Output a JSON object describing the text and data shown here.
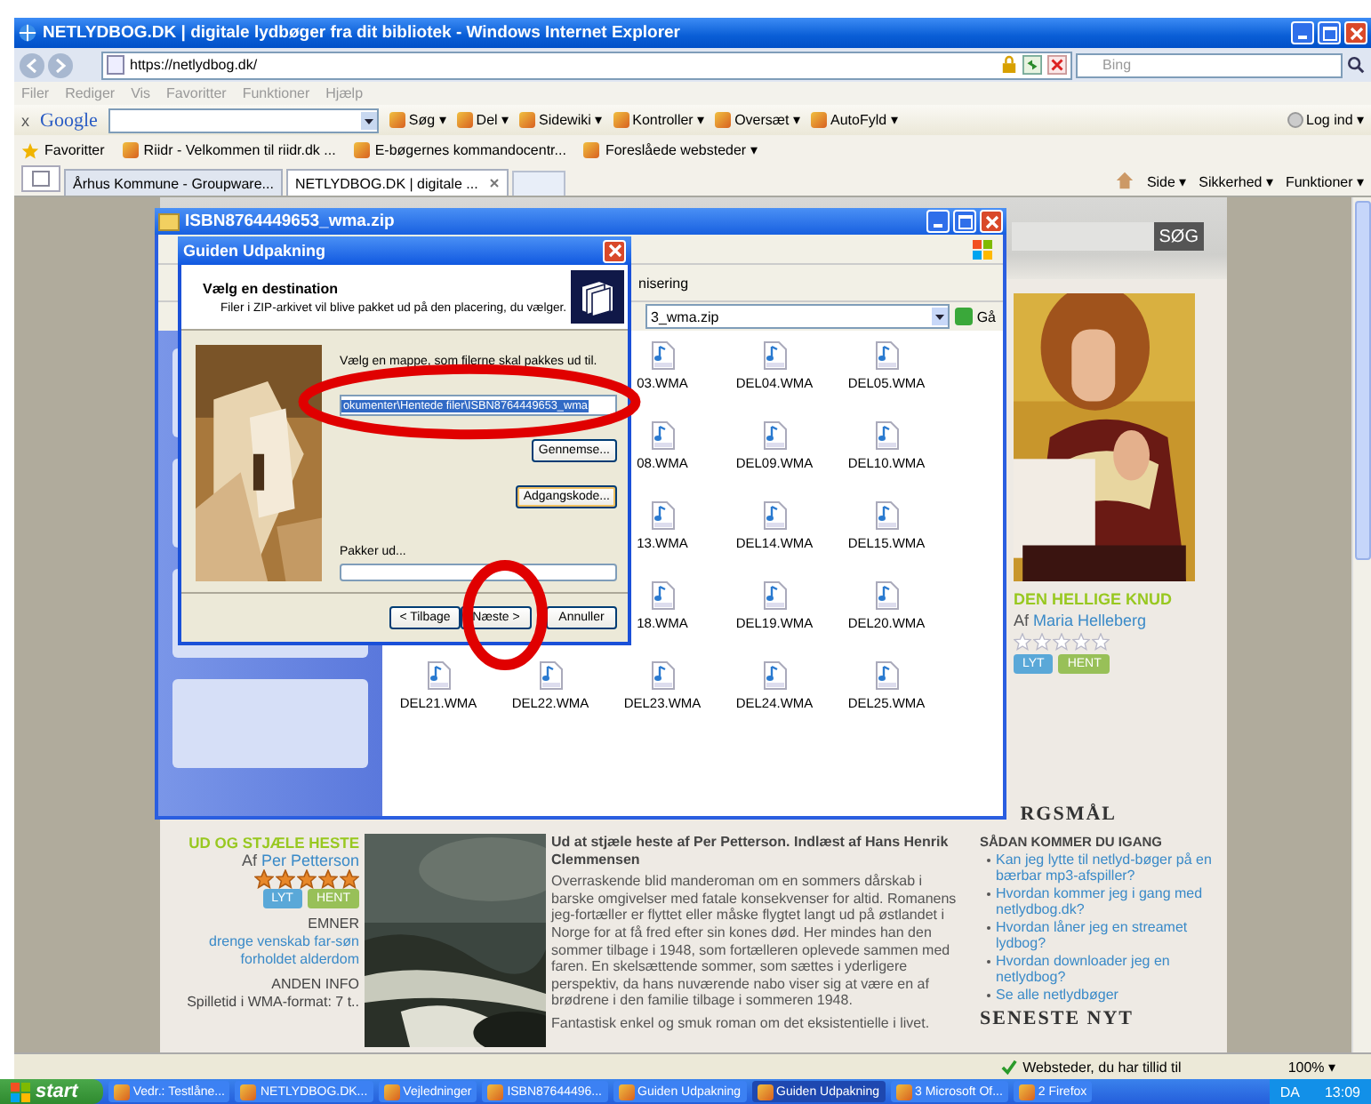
{
  "browser": {
    "title": "NETLYDBOG.DK | digitale lydbøger fra dit bibliotek - Windows Internet Explorer",
    "address": "https://netlydbog.dk/",
    "search_placeholder": "Bing",
    "menu": [
      "Filer",
      "Rediger",
      "Vis",
      "Favoritter",
      "Funktioner",
      "Hjælp"
    ],
    "google_toolbar": {
      "close": "x",
      "logo": "Google",
      "buttons": [
        "Søg ▾",
        "Del ▾",
        "Sidewiki ▾",
        "Kontroller ▾",
        "Oversæt ▾",
        "AutoFyld ▾"
      ],
      "login": "Log ind ▾"
    },
    "favorites_label": "Favoritter",
    "favorites": [
      "Riidr - Velkommen til riidr.dk ...",
      "E-bøgernes kommandocentr...",
      "Foreslåede websteder ▾"
    ],
    "tabs": [
      {
        "label": "Århus Kommune - Groupware...",
        "selected": false
      },
      {
        "label": "NETLYDBOG.DK | digitale ...",
        "selected": true
      }
    ],
    "commands": [
      "Side ▾",
      "Sikkerhed ▾",
      "Funktioner ▾"
    ]
  },
  "page": {
    "search_button": "SØG",
    "featured": {
      "title": "DEN HELLIGE KNUD",
      "author_prefix": "Af",
      "author": "Maria Helleberg",
      "stars": 0,
      "buttons": [
        "LYT",
        "HENT"
      ]
    },
    "faq_heading": "RGSMÅL",
    "book": {
      "title": "UD OG STJÆLE HESTE",
      "author_prefix": "Af",
      "author": "Per Petterson",
      "stars": 5,
      "buttons": [
        "LYT",
        "HENT"
      ],
      "topics_heading": "EMNER",
      "topics": [
        "drenge venskab far-søn",
        "forholdet alderdom"
      ],
      "info_heading": "ANDEN INFO",
      "info": "Spilletid i WMA-format: 7 t..",
      "headline": "Ud at stjæle heste af Per Petterson. Indlæst af Hans Henrik Clemmensen",
      "paragraphs": [
        "Overraskende blid manderoman om en sommers dårskab i barske omgivelser med fatale konsekvenser for altid. Romanens jeg-fortæller er flyttet eller måske flygtet langt ud på østlandet i Norge for at få fred efter sin kones død. Her mindes han den sommer tilbage i 1948, som fortælleren oplevede sammen med faren. En skelsættende sommer, som sættes i yderligere perspektiv, da hans nuværende nabo viser sig at være en af brødrene i den familie tilbage i sommeren 1948.",
        "Fantastisk  enkel og smuk roman om det eksistentielle i livet."
      ]
    },
    "guide": {
      "heading": "SÅDAN KOMMER DU IGANG",
      "links": [
        "Kan jeg lytte til netlyd-bøger på en bærbar mp3-afspiller?",
        "Hvordan kommer jeg i gang med netlydbog.dk?",
        "Hvordan låner jeg en streamet lydbog?",
        "Hvordan downloader jeg en netlydbog?",
        "Se alle netlydbøger"
      ]
    },
    "news_heading": "SENESTE NYT"
  },
  "status_bar": {
    "zone": "Websteder, du har tillid til",
    "zoom": "100% ▾"
  },
  "folder_window": {
    "title": "ISBN8764449653_wma.zip",
    "toolbar_text": "nisering",
    "address": "3_wma.zip",
    "go": "Gå",
    "rows": [
      {
        "files": [
          "03.WMA",
          "DEL04.WMA",
          "DEL05.WMA"
        ]
      },
      {
        "files": [
          "08.WMA",
          "DEL09.WMA",
          "DEL10.WMA"
        ]
      },
      {
        "files": [
          "13.WMA",
          "DEL14.WMA",
          "DEL15.WMA"
        ]
      },
      {
        "files": [
          "18.WMA",
          "DEL19.WMA",
          "DEL20.WMA"
        ]
      },
      {
        "files": [
          "DEL21.WMA",
          "DEL22.WMA",
          "DEL23.WMA",
          "DEL24.WMA",
          "DEL25.WMA"
        ]
      }
    ]
  },
  "dialog": {
    "title": "Guiden Udpakning",
    "heading": "Vælg en destination",
    "subtitle": "Filer i ZIP-arkivet vil blive pakket ud på den placering, du vælger.",
    "prompt": "Vælg en mappe, som filerne skal pakkes ud til.",
    "path": {
      "value": "okumenter\\Hentede filer\\ISBN8764449653_wma",
      "value_selected": true
    },
    "browse": "Gennemse...",
    "password": "Adgangskode...",
    "progress_label": "Pakker ud...",
    "progress": {
      "level": 0
    },
    "buttons": [
      "< Tilbage",
      "Næste >",
      "Annuller"
    ]
  },
  "taskbar": {
    "start": "start",
    "items": [
      {
        "label": "Vedr.: Testlåne...",
        "selected": false
      },
      {
        "label": "NETLYDBOG.DK...",
        "selected": false
      },
      {
        "label": "Vejledninger",
        "selected": false
      },
      {
        "label": "ISBN87644496...",
        "selected": false
      },
      {
        "label": "Guiden Udpakning",
        "selected": false
      },
      {
        "label": "Guiden Udpakning",
        "selected": true
      },
      {
        "label": "3 Microsoft Of...",
        "selected": false
      },
      {
        "label": "2 Firefox",
        "selected": false
      }
    ],
    "language": "DA",
    "clock": "13:09"
  }
}
